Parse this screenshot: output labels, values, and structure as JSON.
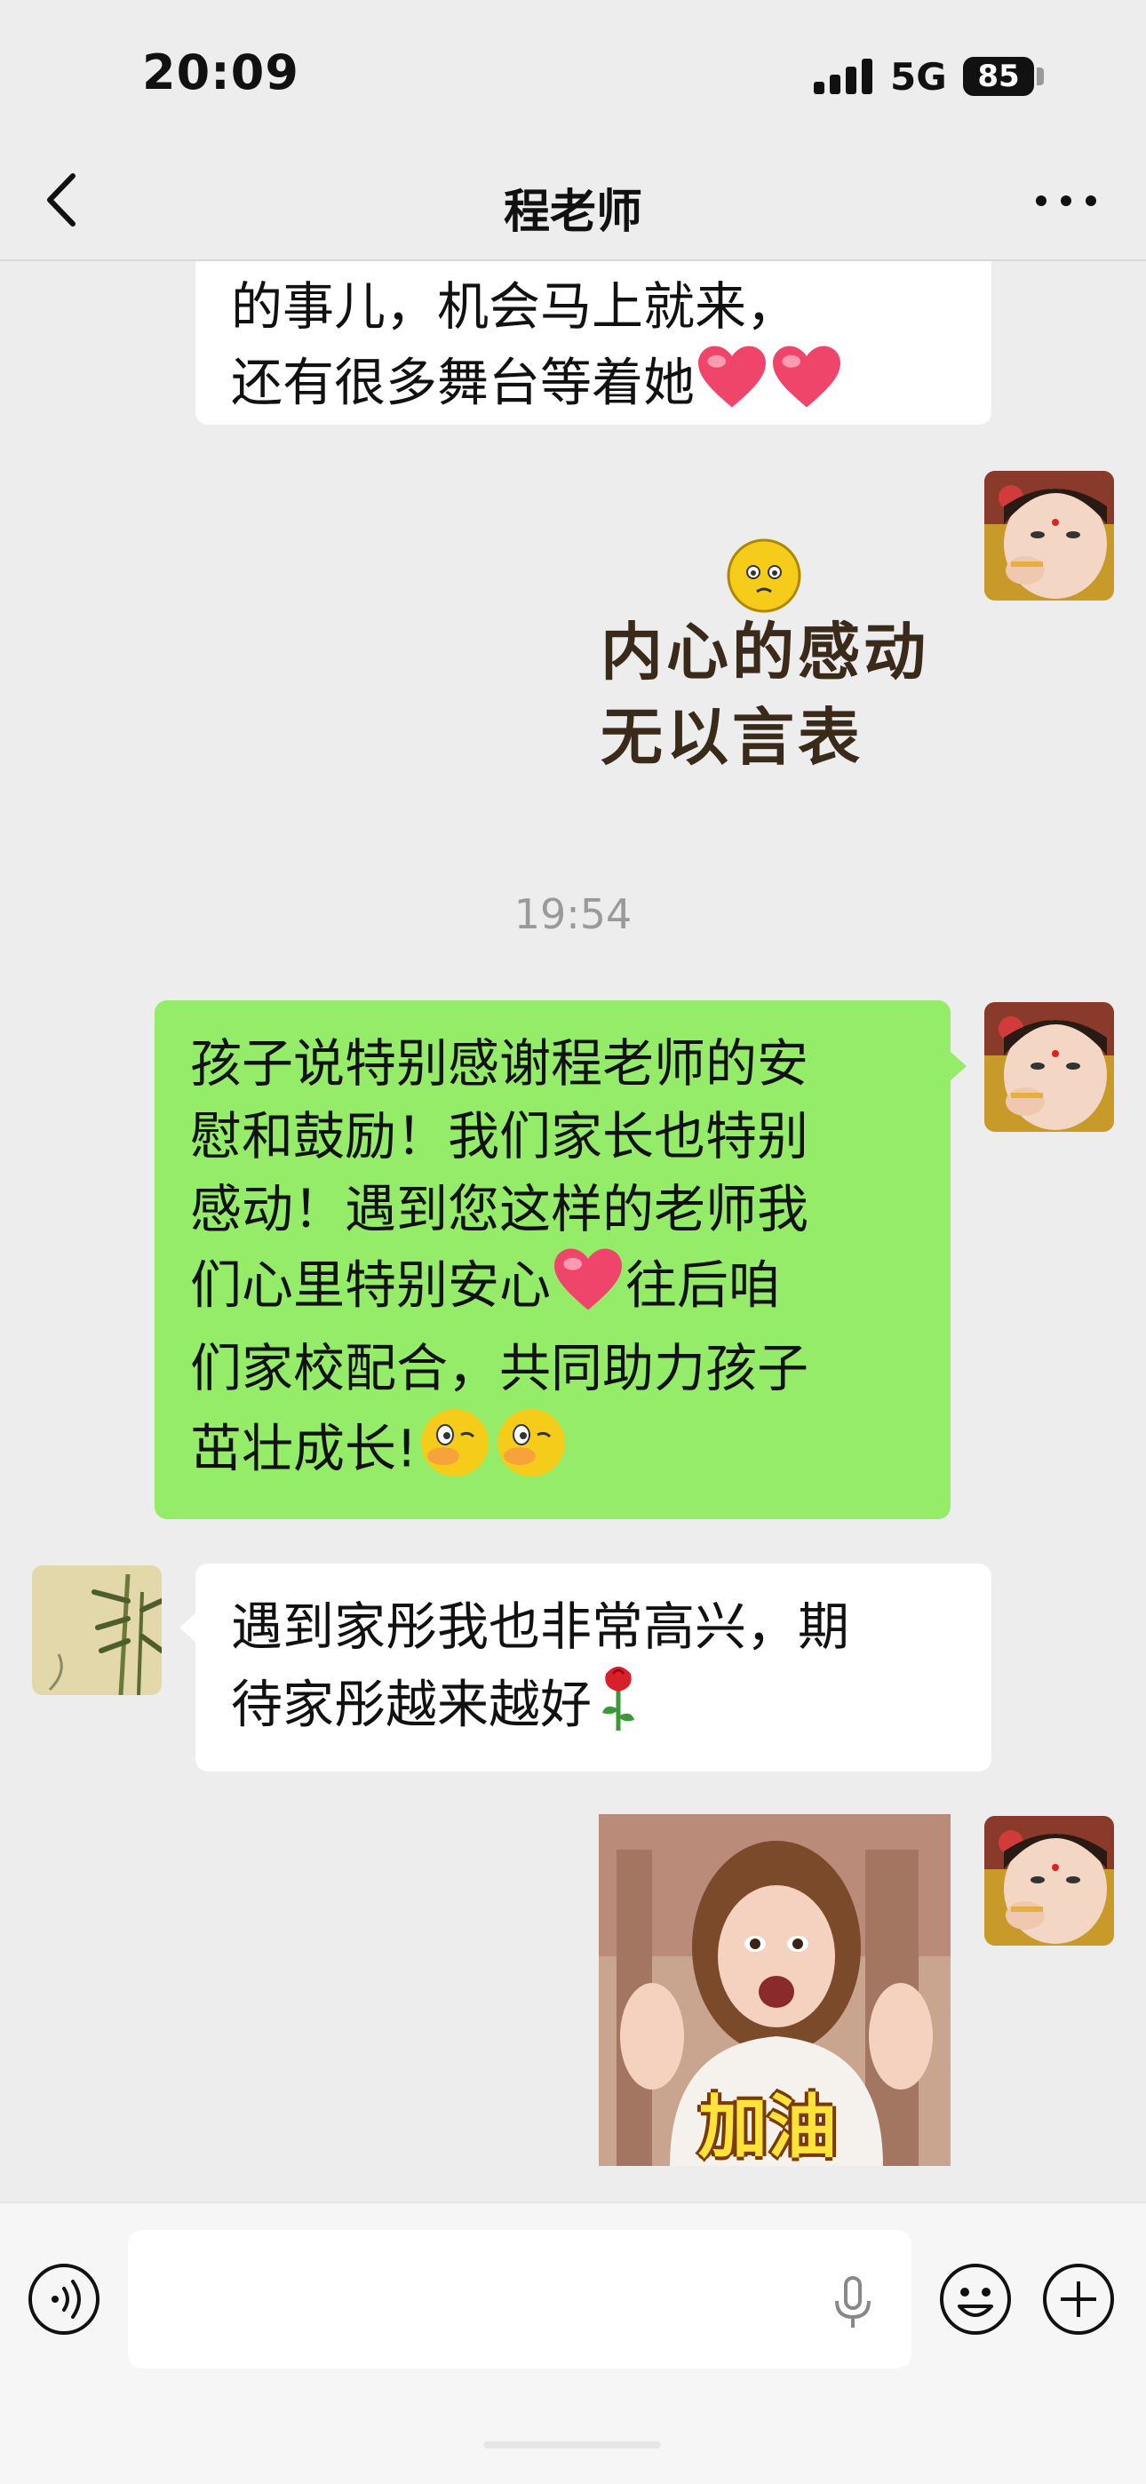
{
  "status_bar": {
    "time": "20:09",
    "network": "5G",
    "battery": "85"
  },
  "nav": {
    "title": "程老师"
  },
  "messages": {
    "m1": {
      "line1": "的事儿，机会马上就来，",
      "line2": "还有很多舞台等着她"
    },
    "sticker1": {
      "line1": "内心的感动",
      "line2": "无以言表"
    },
    "time1": "19:54",
    "m2": {
      "line1": "孩子说特别感谢程老师的安",
      "line2": "慰和鼓励！我们家长也特别",
      "line3": "感动！遇到您这样的老师我",
      "line4a": "们心里特别安心",
      "line4b": "往后咱",
      "line5": "们家校配合，共同助力孩子",
      "line6": "茁壮成长!"
    },
    "m3": {
      "line1": "遇到家彤我也非常高兴，期",
      "line2": "待家彤越来越好"
    },
    "sticker2": {
      "caption": "加油"
    }
  },
  "input_bar": {
    "placeholder": ""
  },
  "colors": {
    "green_bubble": "#95ec69",
    "white_bubble": "#ffffff",
    "background": "#ededed"
  },
  "icons": [
    "back-icon",
    "more-icon",
    "voice-icon",
    "mic-icon",
    "emoji-icon",
    "plus-icon"
  ]
}
